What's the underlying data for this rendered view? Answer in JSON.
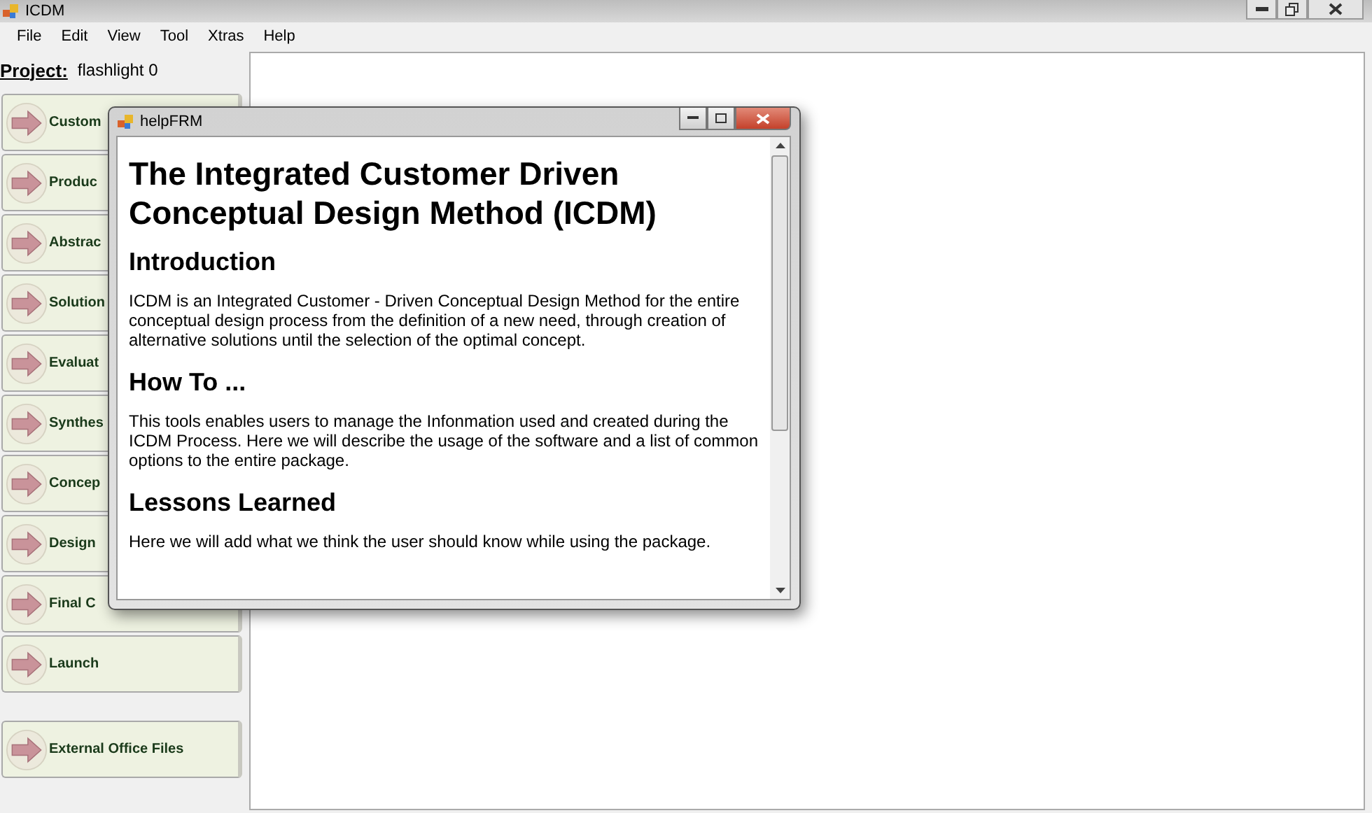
{
  "window": {
    "title": "ICDM"
  },
  "menu": [
    "File",
    "Edit",
    "View",
    "Tool",
    "Xtras",
    "Help"
  ],
  "project": {
    "label": "Project:",
    "value": "flashlight 0"
  },
  "sidebar": {
    "items": [
      {
        "label": "Custom"
      },
      {
        "label": "Produc"
      },
      {
        "label": "Abstrac"
      },
      {
        "label": "Solution"
      },
      {
        "label": "Evaluat"
      },
      {
        "label": "Synthes"
      },
      {
        "label": "Concep"
      },
      {
        "label": "Design"
      },
      {
        "label": "Final C"
      },
      {
        "label": "Launch"
      }
    ],
    "extra_item": {
      "label": "External Office Files"
    }
  },
  "help_window": {
    "title": "helpFRM",
    "heading": "The Integrated Customer Driven Conceptual Design Method (ICDM)",
    "sections": [
      {
        "title": "Introduction",
        "text": "ICDM is an Integrated Customer - Driven Conceptual Design Method for the entire conceptual design process from the definition of a new need, through creation of alternative solutions until the selection of the optimal concept."
      },
      {
        "title": "How To ...",
        "text": "This tools enables users to manage the Infonmation used and created during the ICDM Process. Here we will describe the usage of the software and a list of common options to the entire package."
      },
      {
        "title": "Lessons Learned",
        "text": "Here we will add what we think the user should know while using the package."
      }
    ]
  }
}
